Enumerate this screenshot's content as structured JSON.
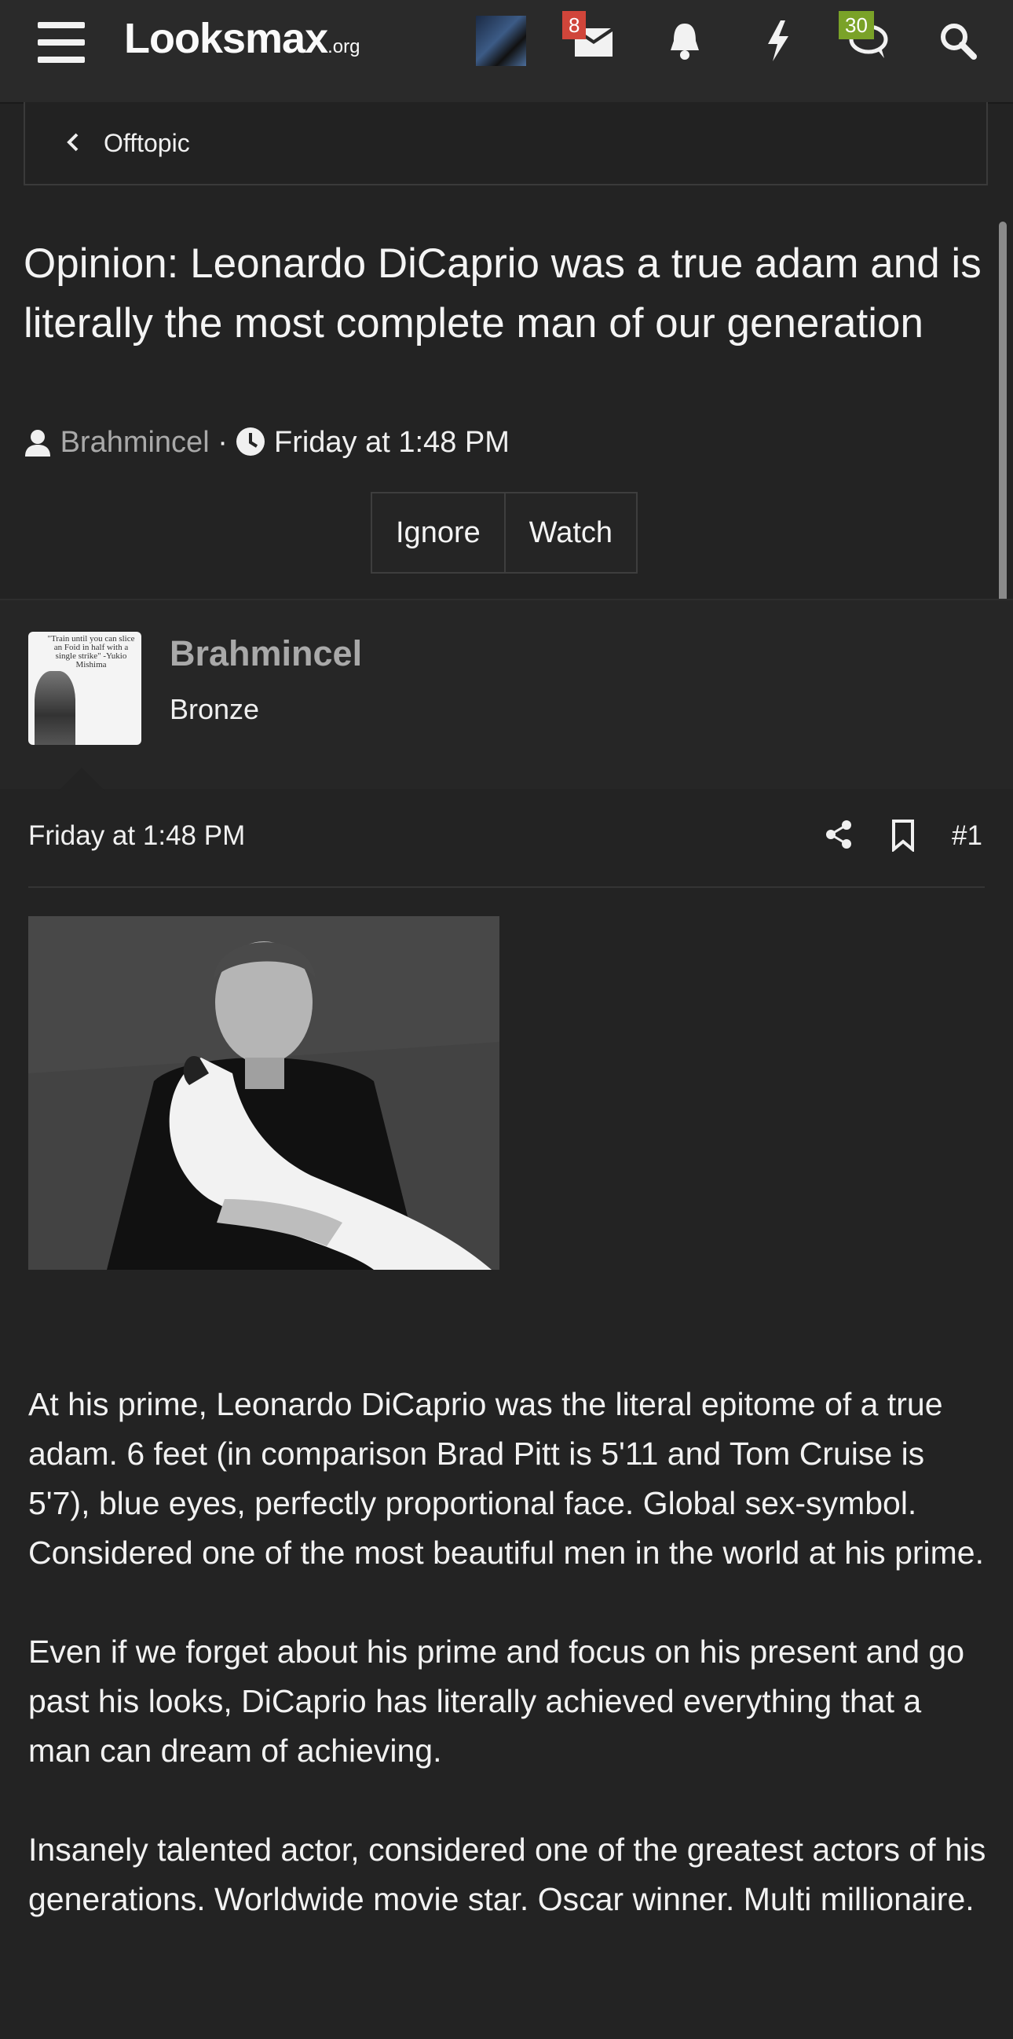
{
  "header": {
    "logo_main": "Looksmax",
    "logo_suffix": ".org",
    "messages_badge": "8",
    "chat_badge": "30"
  },
  "breadcrumb": {
    "label": "Offtopic"
  },
  "thread": {
    "title": "Opinion: Leonardo DiCaprio was a true adam and is literally the most complete man of our generation",
    "author": "Brahmincel",
    "separator": "·",
    "date": "Friday at 1:48 PM",
    "buttons": {
      "ignore": "Ignore",
      "watch": "Watch"
    }
  },
  "post": {
    "username": "Brahmincel",
    "user_title": "Bronze",
    "avatar_quote": "\"Train until you can slice an Foid in half with a single strike\" -Yukio Mishima",
    "date": "Friday at 1:48 PM",
    "number": "#1",
    "paragraphs": [
      "At his prime, Leonardo DiCaprio was the literal epitome of a true adam. 6 feet (in comparison Brad Pitt is 5'11 and Tom Cruise is 5'7), blue eyes, perfectly proportional face. Global sex-symbol. Considered one of the most beautiful men in the world at his prime.",
      "Even if we forget about his prime and focus on his present and go past his looks, DiCaprio has literally achieved everything that a man can dream of achieving.",
      "Insanely talented actor, considered one of the greatest actors of his generations. Worldwide movie star. Oscar winner. Multi millionaire."
    ]
  }
}
